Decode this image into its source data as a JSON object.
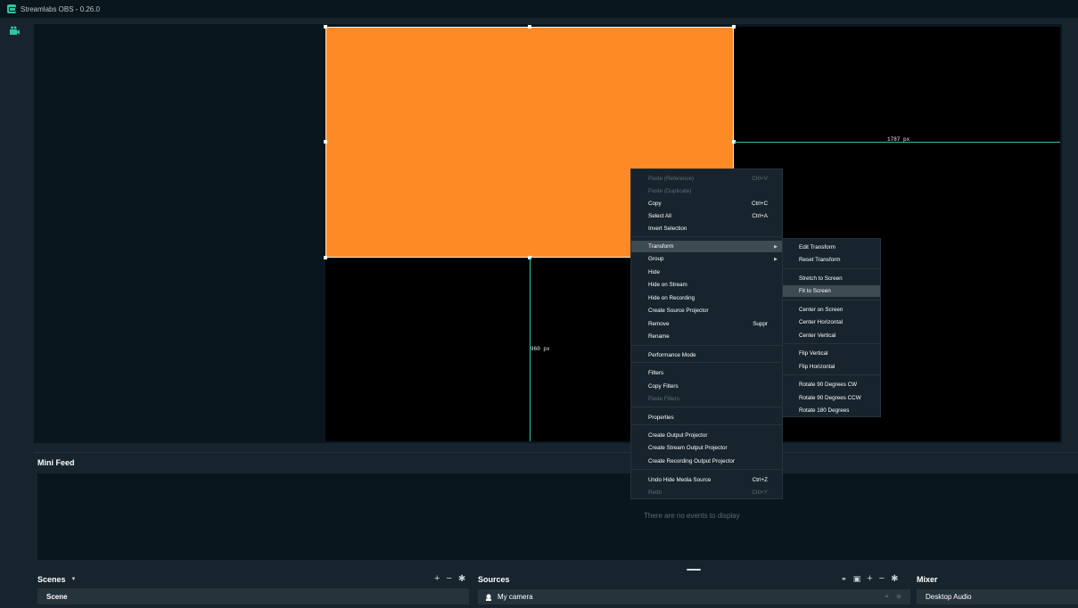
{
  "window": {
    "title": "Streamlabs OBS - 0.26.0"
  },
  "preview": {
    "width_guide_label": "1787 px",
    "height_guide_label": "960 px"
  },
  "context_menu": {
    "items": [
      {
        "label": "Paste (Reference)",
        "shortcut": "Ctrl+V",
        "disabled": true
      },
      {
        "label": "Paste (Duplicate)",
        "shortcut": "",
        "disabled": true
      },
      {
        "label": "Copy",
        "shortcut": "Ctrl+C",
        "disabled": false
      },
      {
        "label": "Select All",
        "shortcut": "Ctrl+A",
        "disabled": false
      },
      {
        "label": "Invert Selection",
        "shortcut": "",
        "disabled": false
      },
      {
        "label": "Transform",
        "shortcut": "",
        "disabled": false,
        "submenu": true,
        "active": true
      },
      {
        "label": "Group",
        "shortcut": "",
        "disabled": false,
        "submenu": true
      },
      {
        "label": "Hide",
        "shortcut": "",
        "disabled": false
      },
      {
        "label": "Hide on Stream",
        "shortcut": "",
        "disabled": false
      },
      {
        "label": "Hide on Recording",
        "shortcut": "",
        "disabled": false
      },
      {
        "label": "Create Source Projector",
        "shortcut": "",
        "disabled": false
      },
      {
        "label": "Remove",
        "shortcut": "Suppr",
        "disabled": false
      },
      {
        "label": "Rename",
        "shortcut": "",
        "disabled": false
      },
      {
        "label": "Performance Mode",
        "shortcut": "",
        "disabled": false
      },
      {
        "label": "Filters",
        "shortcut": "",
        "disabled": false
      },
      {
        "label": "Copy Filters",
        "shortcut": "",
        "disabled": false
      },
      {
        "label": "Paste Filters",
        "shortcut": "",
        "disabled": true
      },
      {
        "label": "Properties",
        "shortcut": "",
        "disabled": false
      },
      {
        "label": "Create Output Projector",
        "shortcut": "",
        "disabled": false
      },
      {
        "label": "Create Stream Output Projector",
        "shortcut": "",
        "disabled": false
      },
      {
        "label": "Create Recording Output Projector",
        "shortcut": "",
        "disabled": false
      },
      {
        "label": "Undo Hide Media Source",
        "shortcut": "Ctrl+Z",
        "disabled": false
      },
      {
        "label": "Redo",
        "shortcut": "Ctrl+Y",
        "disabled": true
      }
    ]
  },
  "transform_submenu": {
    "items": [
      {
        "label": "Edit Transform"
      },
      {
        "label": "Reset Transform"
      },
      {
        "label": "Stretch to Screen"
      },
      {
        "label": "Fit to Screen",
        "active": true
      },
      {
        "label": "Center on Screen"
      },
      {
        "label": "Center Horizontal"
      },
      {
        "label": "Center Vertical"
      },
      {
        "label": "Flip Vertical"
      },
      {
        "label": "Flip Horizontal"
      },
      {
        "label": "Rotate 90 Degrees CW"
      },
      {
        "label": "Rotate 90 Degrees CCW"
      },
      {
        "label": "Rotate 180 Degrees"
      }
    ]
  },
  "minifeed": {
    "title": "Mini Feed",
    "empty_text": "There are no events to display"
  },
  "scenes": {
    "title": "Scenes",
    "items": [
      {
        "label": "Scene"
      }
    ]
  },
  "sources": {
    "title": "Sources",
    "items": [
      {
        "label": "My camera"
      }
    ]
  },
  "mixer": {
    "title": "Mixer",
    "items": [
      {
        "label": "Desktop Audio"
      }
    ]
  },
  "colors": {
    "accent": "#31c3a2",
    "source_fill": "#fe8a26",
    "background": "#09161d",
    "panel": "#17242d"
  }
}
